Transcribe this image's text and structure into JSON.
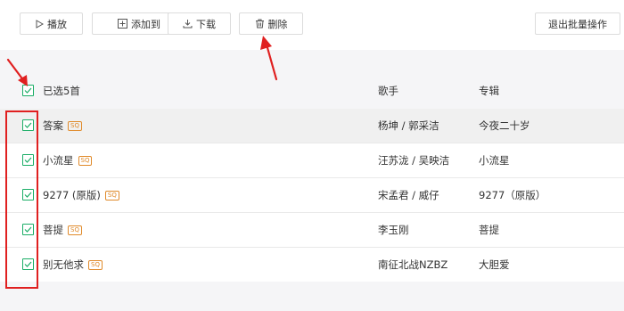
{
  "toolbar": {
    "play_label": "播放",
    "add_to_label": "添加到",
    "download_label": "下载",
    "delete_label": "删除",
    "exit_batch_label": "退出批量操作"
  },
  "list": {
    "selected_count_label": "已选5首",
    "artist_header": "歌手",
    "album_header": "专辑",
    "songs": [
      {
        "title": "答案",
        "quality": "SQ",
        "artist": "杨坤 / 郭采洁",
        "album": "今夜二十岁",
        "checked": true
      },
      {
        "title": "小流星",
        "quality": "SQ",
        "artist": "汪苏泷 / 吴映洁",
        "album": "小流星",
        "checked": true
      },
      {
        "title": "9277 (原版)",
        "quality": "SQ",
        "artist": "宋孟君 / 威仔",
        "album": "9277（原版）",
        "checked": true
      },
      {
        "title": "菩提",
        "quality": "SQ",
        "artist": "李玉刚",
        "album": "菩提",
        "checked": true
      },
      {
        "title": "别无他求",
        "quality": "SQ",
        "artist": "南征北战NZBZ",
        "album": "大胆爱",
        "checked": true
      }
    ]
  },
  "colors": {
    "accent_green": "#1aad66",
    "annotation_red": "#e02020",
    "sq_badge": "#e08a2a"
  }
}
